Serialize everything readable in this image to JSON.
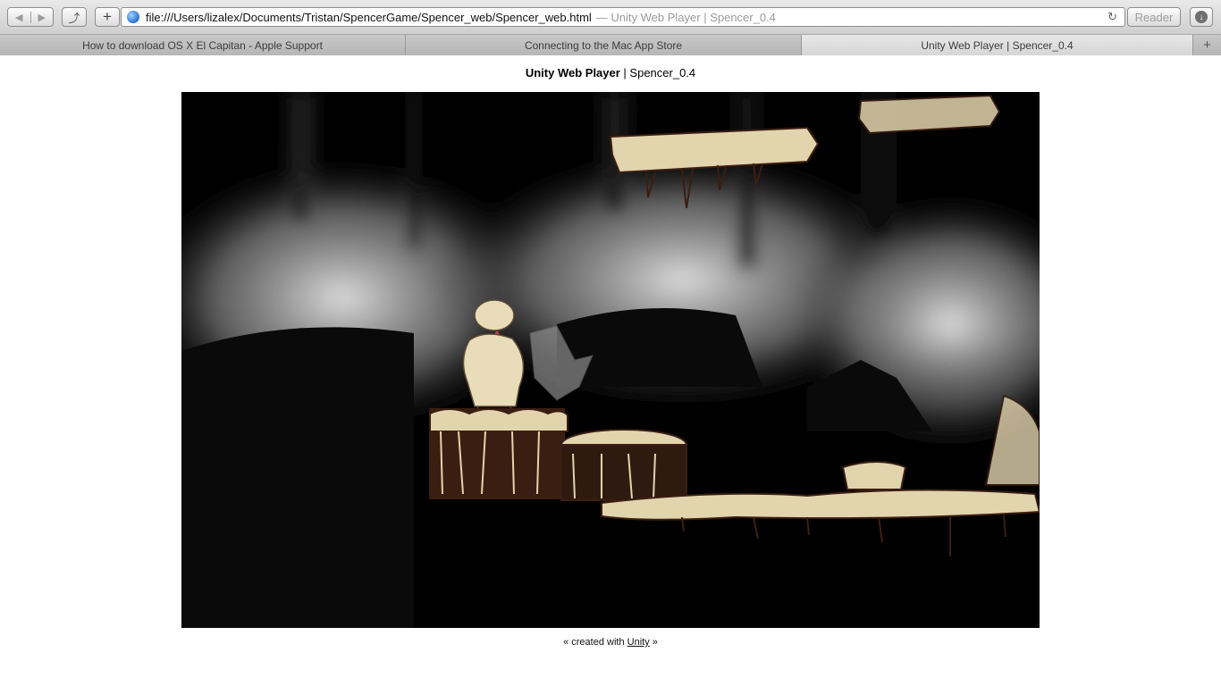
{
  "toolbar": {
    "back_icon": "◀",
    "forward_icon": "▶",
    "share_icon": "⤴",
    "add_icon": "+",
    "url": "file:///Users/lizalex/Documents/Tristan/SpencerGame/Spencer_web/Spencer_web.html",
    "url_title": "— Unity Web Player | Spencer_0.4",
    "reload_icon": "↻",
    "reader_label": "Reader",
    "download_icon": "↓"
  },
  "tabs": [
    {
      "label": "How to download OS X El Capitan - Apple Support",
      "active": false
    },
    {
      "label": "Connecting to the Mac App Store",
      "active": false
    },
    {
      "label": "Unity Web Player | Spencer_0.4",
      "active": true
    }
  ],
  "new_tab_icon": "+",
  "page": {
    "heading_bold": "Unity Web Player",
    "heading_sep": " | ",
    "heading_rest": "Spencer_0.4",
    "footer_prefix": "« created with ",
    "footer_link": "Unity",
    "footer_suffix": " »"
  },
  "colors": {
    "sketch": "#e2d4ad",
    "ink": "#3a1e12",
    "background": "#000000"
  }
}
